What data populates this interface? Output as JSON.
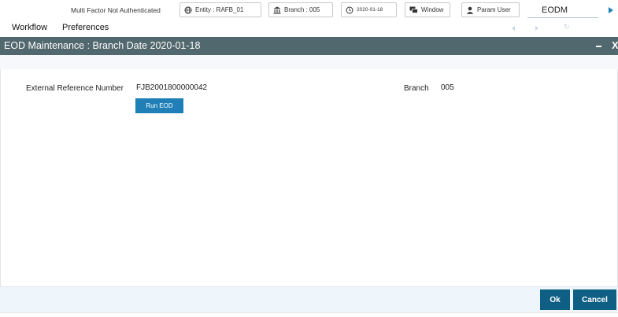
{
  "topbar": {
    "mfa_status": "Multi Factor Not Authenticated",
    "entity": "Entity : RAFB_01",
    "branch": "Branch : 005",
    "date": "2020-01-18",
    "window": "Window",
    "user": "Param User",
    "app_name": "EODM",
    "accent_color": "#1f7fb6"
  },
  "menu": {
    "workflow": "Workflow",
    "preferences": "Preferences"
  },
  "window": {
    "title": "EOD Maintenance : Branch Date 2020-01-18",
    "close_glyph": "X",
    "titlebar_color": "#52686f"
  },
  "form": {
    "external_reference_label": "External Reference Number",
    "external_reference_value": "FJB2001800000042",
    "branch_label": "Branch",
    "branch_value": "005",
    "run_eod_label": "Run EOD"
  },
  "footer": {
    "ok_label": "Ok",
    "cancel_label": "Cancel",
    "button_color": "#0f5f85"
  },
  "icons": [
    "globe-icon",
    "bank-icon",
    "clock-icon",
    "window-icon",
    "user-icon",
    "play-arrow-icon",
    "nav-left-icon",
    "nav-right-icon",
    "refresh-icon",
    "minimize-icon",
    "close-icon"
  ]
}
